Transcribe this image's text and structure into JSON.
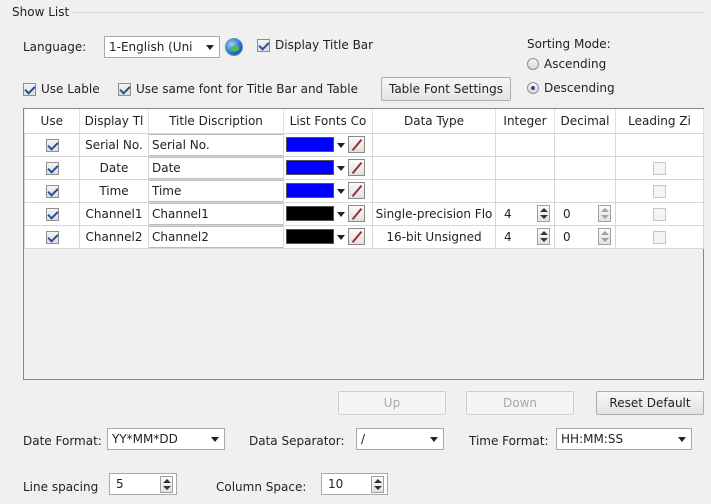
{
  "group": {
    "title": "Show List"
  },
  "language": {
    "label": "Language:",
    "value": "1-English (Uni"
  },
  "display_title_bar": {
    "label": "Display Title Bar",
    "checked": true
  },
  "sorting": {
    "label": "Sorting Mode:",
    "options": [
      {
        "label": "Ascending",
        "selected": false
      },
      {
        "label": "Descending",
        "selected": true
      }
    ]
  },
  "use_label": {
    "label": "Use Lable",
    "checked": true
  },
  "same_font": {
    "label": "Use same font for Title Bar and Table",
    "checked": true
  },
  "table_font_button": "Table Font Settings",
  "table": {
    "headers": [
      "Use",
      "Display Tl",
      "Title Discription",
      "List Fonts Co",
      "Data Type",
      "Integer",
      "Decimal",
      "Leading Zi"
    ],
    "rows": [
      {
        "use": true,
        "display": "Serial No.",
        "title": "Serial No.",
        "color": "#0000ff",
        "data_type": "",
        "integer": "",
        "decimal": "",
        "leading": null
      },
      {
        "use": true,
        "display": "Date",
        "title": "Date",
        "color": "#0000ff",
        "data_type": "",
        "integer": "",
        "decimal": "",
        "leading": false
      },
      {
        "use": true,
        "display": "Time",
        "title": "Time",
        "color": "#0000ff",
        "data_type": "",
        "integer": "",
        "decimal": "",
        "leading": false
      },
      {
        "use": true,
        "display": "Channel1",
        "title": "Channel1",
        "color": "#000000",
        "data_type": "Single-precision Flo",
        "integer": "4",
        "decimal": "0",
        "leading": false
      },
      {
        "use": true,
        "display": "Channel2",
        "title": "Channel2",
        "color": "#000000",
        "data_type": "16-bit Unsigned",
        "integer": "4",
        "decimal": "0",
        "leading": false
      }
    ]
  },
  "buttons": {
    "up": "Up",
    "down": "Down",
    "reset": "Reset Default"
  },
  "date_format": {
    "label": "Date Format:",
    "value": "YY*MM*DD"
  },
  "data_separator": {
    "label": "Data Separator:",
    "value": "/"
  },
  "time_format": {
    "label": "Time Format:",
    "value": "HH:MM:SS"
  },
  "line_spacing": {
    "label": "Line spacing",
    "value": "5"
  },
  "column_space": {
    "label": "Column Space:",
    "value": "10"
  }
}
